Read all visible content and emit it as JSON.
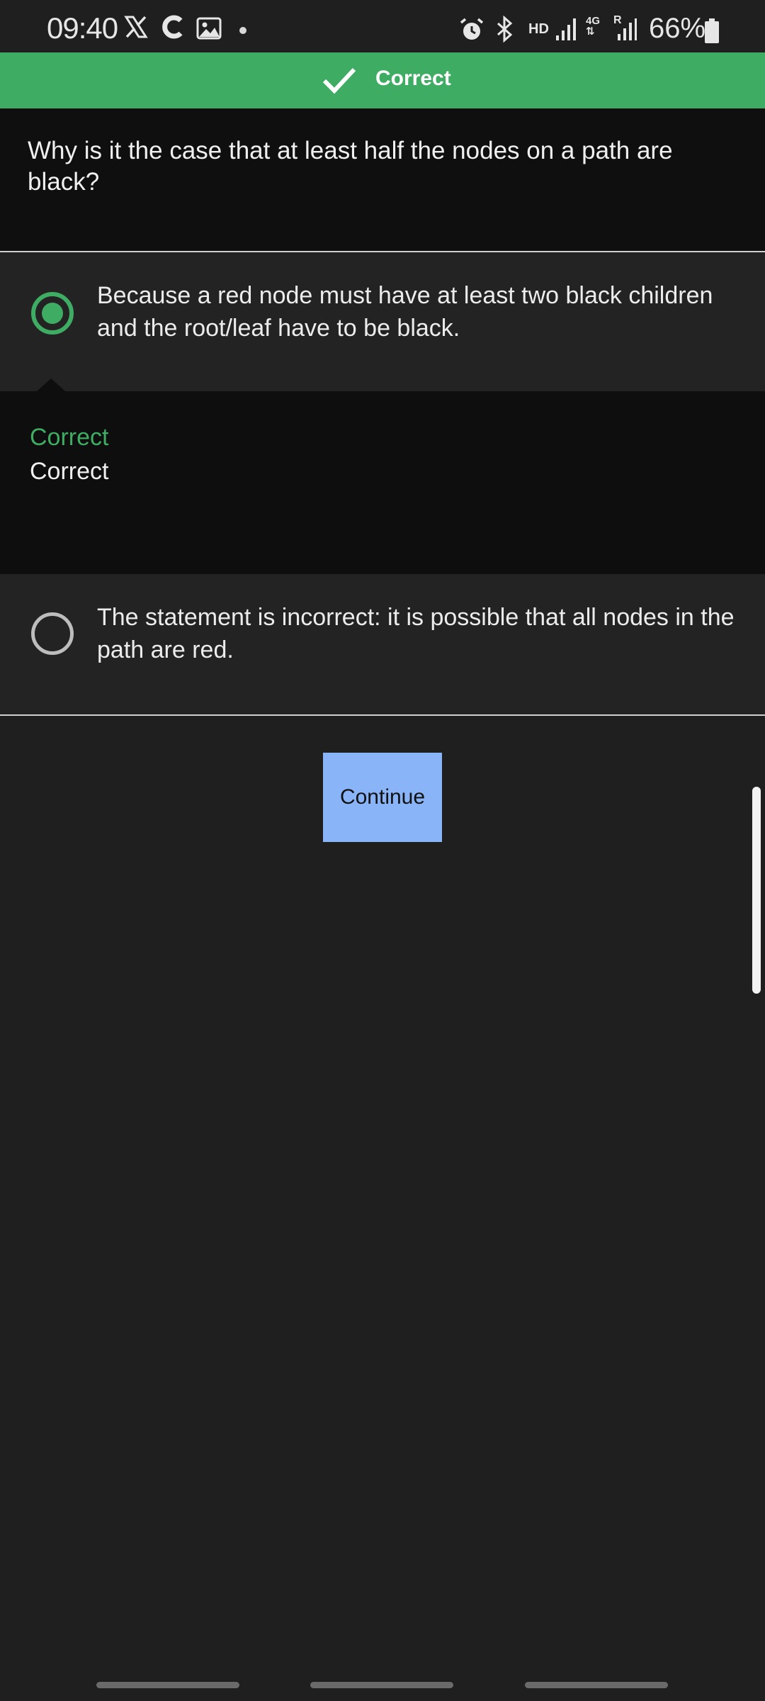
{
  "status_bar": {
    "time": "09:40",
    "hd": "HD",
    "network_type": "4G",
    "roaming": "R",
    "battery": "66%"
  },
  "banner": {
    "label": "Correct",
    "color": "#3fac63"
  },
  "question": {
    "text": "Why is it the case that at least half the nodes on a path are black?"
  },
  "options": [
    {
      "text": "Because a red node must have at least two black children and the root/leaf have to be black.",
      "selected": true
    },
    {
      "text": "The statement is incorrect: it is possible that all nodes in the path are red.",
      "selected": false
    }
  ],
  "feedback": {
    "title": "Correct",
    "body": "Correct"
  },
  "continue_button": {
    "label": "Continue",
    "color": "#8ab4f8"
  }
}
